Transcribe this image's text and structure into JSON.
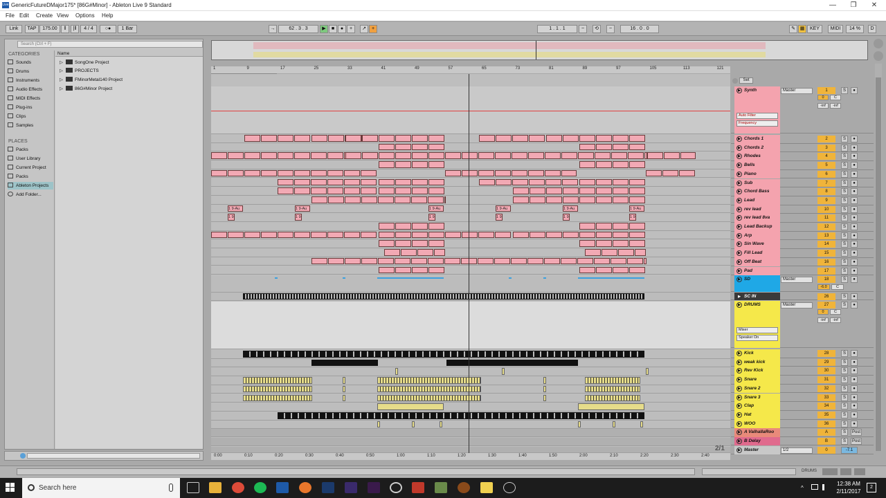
{
  "window": {
    "title": "GenericFutureDMajor175* [86G#Minor] - Ableton Live 9 Standard",
    "app_icon": "Live",
    "minimize": "—",
    "restore": "❐",
    "close": "✕"
  },
  "menu": [
    "File",
    "Edit",
    "Create",
    "View",
    "Options",
    "Help"
  ],
  "control_bar": {
    "link": "Link",
    "tap": "TAP",
    "tempo": "175.00",
    "signature": "4 / 4",
    "quantize": "1 Bar",
    "position": "62 . 3 . 3",
    "loop_start": "1 . 1 . 1",
    "loop_length": "16 . 0 . 0",
    "key": "KEY",
    "midi": "MIDI",
    "cpu": "14 %",
    "d": "D"
  },
  "browser": {
    "search_placeholder": "Search (Ctrl + F)",
    "categories_label": "CATEGORIES",
    "categories": [
      "Sounds",
      "Drums",
      "Instruments",
      "Audio Effects",
      "MIDI Effects",
      "Plug-ins",
      "Clips",
      "Samples"
    ],
    "places_label": "PLACES",
    "places": [
      "Packs",
      "User Library",
      "Current Project",
      "Packs",
      "Ableton Projects",
      "Add Folder..."
    ],
    "name_header": "Name",
    "files": [
      "SongOne Project",
      "PROJECTS",
      "FMinorMetal140 Project",
      "86G#Minor Project"
    ]
  },
  "beat_ruler": [
    "1",
    "9",
    "17",
    "25",
    "33",
    "41",
    "49",
    "57",
    "65",
    "73",
    "81",
    "89",
    "97",
    "105",
    "113",
    "121"
  ],
  "time_ruler": [
    "0:00",
    "0:10",
    "0:20",
    "0:30",
    "0:40",
    "0:50",
    "1:00",
    "1:10",
    "1:20",
    "1:30",
    "1:40",
    "1:50",
    "2:00",
    "2:10",
    "2:20",
    "2:30",
    "2:40"
  ],
  "page_indicator": "2/1",
  "set_label": "Set",
  "synth_group": {
    "name": "Synth",
    "output": "Master",
    "num": "1",
    "vol": "0",
    "pan": "C",
    "inf1": "-inf",
    "inf2": "-inf",
    "device": "Auto Filter",
    "param": "Frequency"
  },
  "synth_tracks": [
    {
      "name": "Chords 1",
      "num": "2"
    },
    {
      "name": "Chords 2",
      "num": "3"
    },
    {
      "name": "Rhodes",
      "num": "4"
    },
    {
      "name": "Bells",
      "num": "5"
    },
    {
      "name": "Piano",
      "num": "6"
    },
    {
      "name": "Sub",
      "num": "7"
    },
    {
      "name": "Chord Bass",
      "num": "8"
    },
    {
      "name": "Lead",
      "num": "9"
    },
    {
      "name": "rev lead",
      "num": "10"
    },
    {
      "name": "rev lead 8va",
      "num": "11"
    },
    {
      "name": "Lead Backup",
      "num": "12"
    },
    {
      "name": "Arp",
      "num": "13"
    },
    {
      "name": "Sin Wave",
      "num": "14"
    },
    {
      "name": "Fill Lead",
      "num": "15"
    },
    {
      "name": "Off Beat",
      "num": "16"
    },
    {
      "name": "Pad",
      "num": "17"
    }
  ],
  "sd_group": {
    "name": "SD",
    "output": "Master",
    "num": "18",
    "vol": "-6.0",
    "pan": "C"
  },
  "sc_in": {
    "name": "SC IN",
    "num": "26"
  },
  "drums_group": {
    "name": "DRUMS",
    "output": "Master",
    "num": "27",
    "vol": "0",
    "pan": "C",
    "inf1": "-inf",
    "inf2": "-inf",
    "device": "Mixer",
    "param": "Speaker On"
  },
  "drum_tracks": [
    {
      "name": "Kick",
      "num": "28"
    },
    {
      "name": "weak kick",
      "num": "29"
    },
    {
      "name": "Rev Kick",
      "num": "30"
    },
    {
      "name": "Snare",
      "num": "31"
    },
    {
      "name": "Snare 2",
      "num": "32"
    },
    {
      "name": "Snare 3",
      "num": "33"
    },
    {
      "name": "Clap",
      "num": "34"
    },
    {
      "name": "Hat",
      "num": "35"
    },
    {
      "name": "WOO",
      "num": "36"
    }
  ],
  "returns": [
    {
      "name": "A ValhallaRoo",
      "letter": "A",
      "post": "Post"
    },
    {
      "name": "B Delay",
      "letter": "B",
      "post": "Post"
    }
  ],
  "master": {
    "name": "Master",
    "sel": "1/2",
    "num": "0",
    "vol": "-7.1"
  },
  "clip_label": "1 9-Au",
  "clip_label_short": "1 9",
  "status": {
    "drums_label": "DRUMS"
  },
  "taskbar": {
    "search": "Search here",
    "time": "12:38 AM",
    "date": "2/11/2017",
    "notif": "2"
  },
  "colors": {
    "synth": "#f4a3ae",
    "sd": "#1fa8e6",
    "drums": "#f5e84a",
    "return_a": "#e98a7a",
    "return_b": "#e06a8d",
    "master": "#c8c8c8",
    "clip_pink": "#f2a9b4",
    "num_orange": "#f0b43a"
  }
}
